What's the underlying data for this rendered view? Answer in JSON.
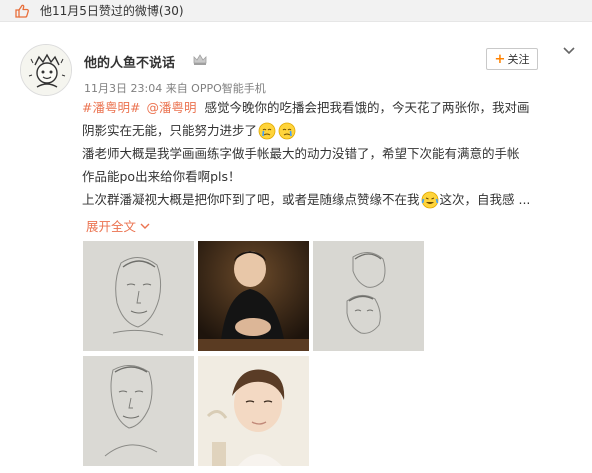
{
  "header": {
    "text": "他11月5日赞过的微博(30)",
    "icon": "thumbs-up-icon"
  },
  "post": {
    "username": "他的人鱼不说话",
    "badge_icon": "crown-icon",
    "meta": "11月3日 23:04 来自 OPPO智能手机",
    "follow_label": "关注",
    "follow_plus": "+",
    "lines": {
      "l1_tag1": "#潘粤明#",
      "l1_at": "@潘粤明",
      "l1_text": "感觉今晚你的吃播会把我看饿的，今天花了两张你，我对画",
      "l2_text": "阴影实在无能，只能努力进步了",
      "l3_text": "潘老师大概是我学画画练字做手帐最大的动力没错了，希望下次能有满意的手帐",
      "l4_text": "作品能po出来给你看啊pls！",
      "l5_text_a": "上次群潘凝视大概是把你吓到了吧，或者是随缘点赞缘不在我",
      "l5_text_b": "这次，自我感 ..."
    },
    "expand_label": "展开全文",
    "photos": [
      {
        "name": "sketch-portrait-1"
      },
      {
        "name": "photo-man-black-shirt"
      },
      {
        "name": "sketch-portrait-2"
      },
      {
        "name": "sketch-portrait-3"
      },
      {
        "name": "photo-man-closeup"
      }
    ]
  },
  "colors": {
    "link": "#eb7350",
    "accent": "#ff8200",
    "meta": "#808080",
    "header_bg": "#f2f2f2"
  }
}
